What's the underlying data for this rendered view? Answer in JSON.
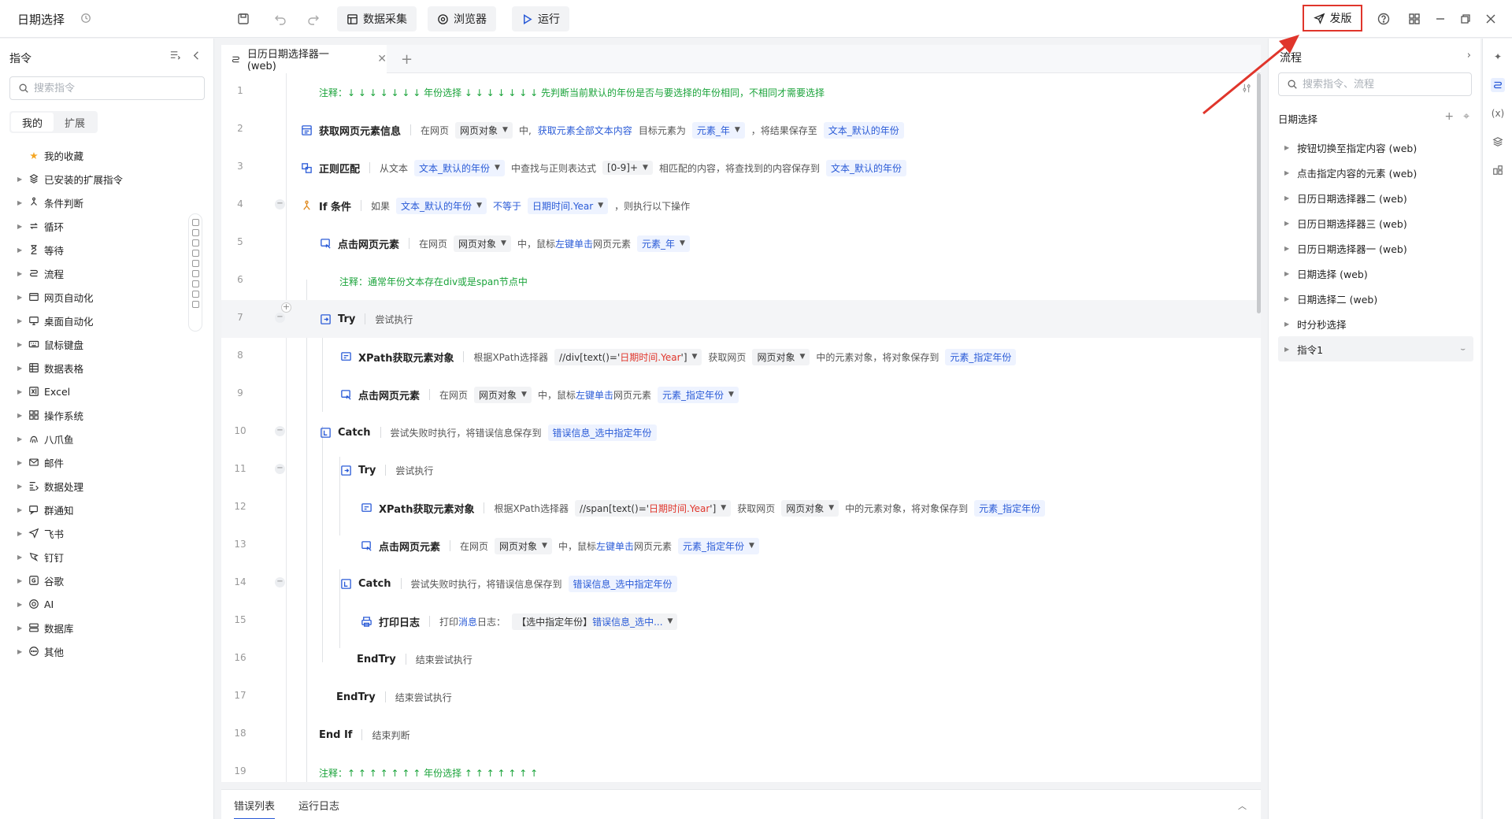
{
  "app": {
    "title": "日期选择",
    "toolbar": {
      "data_collect": "数据采集",
      "browser": "浏览器",
      "run": "运行",
      "publish": "发版"
    }
  },
  "left_panel": {
    "title": "指令",
    "search_placeholder": "搜索指令",
    "tabs": [
      "我的",
      "扩展"
    ],
    "categories": [
      {
        "label": "我的收藏",
        "icon": "star-icon",
        "caret": ""
      },
      {
        "label": "已安装的扩展指令",
        "icon": "extension-icon",
        "caret": "▶"
      },
      {
        "label": "条件判断",
        "icon": "branch-icon",
        "caret": "▶"
      },
      {
        "label": "循环",
        "icon": "loop-icon",
        "caret": "▶"
      },
      {
        "label": "等待",
        "icon": "hourglass-icon",
        "caret": "▶"
      },
      {
        "label": "流程",
        "icon": "flow-icon",
        "caret": "▶"
      },
      {
        "label": "网页自动化",
        "icon": "browser-window-icon",
        "caret": "▶"
      },
      {
        "label": "桌面自动化",
        "icon": "desktop-icon",
        "caret": "▶"
      },
      {
        "label": "鼠标键盘",
        "icon": "keyboard-icon",
        "caret": "▶"
      },
      {
        "label": "数据表格",
        "icon": "table-icon",
        "caret": "▶"
      },
      {
        "label": "Excel",
        "icon": "excel-icon",
        "caret": "▶"
      },
      {
        "label": "操作系统",
        "icon": "os-icon",
        "caret": "▶"
      },
      {
        "label": "八爪鱼",
        "icon": "octopus-icon",
        "caret": "▶"
      },
      {
        "label": "邮件",
        "icon": "mail-icon",
        "caret": "▶"
      },
      {
        "label": "数据处理",
        "icon": "data-process-icon",
        "caret": "▶"
      },
      {
        "label": "群通知",
        "icon": "group-notify-icon",
        "caret": "▶"
      },
      {
        "label": "飞书",
        "icon": "feishu-icon",
        "caret": "▶"
      },
      {
        "label": "钉钉",
        "icon": "dingtalk-icon",
        "caret": "▶"
      },
      {
        "label": "谷歌",
        "icon": "google-icon",
        "caret": "▶"
      },
      {
        "label": "AI",
        "icon": "ai-icon",
        "caret": "▶"
      },
      {
        "label": "数据库",
        "icon": "database-icon",
        "caret": "▶"
      },
      {
        "label": "其他",
        "icon": "more-icon",
        "caret": "▶"
      }
    ]
  },
  "editor": {
    "tab_label": "日历日期选择器一 (web)",
    "lines": [
      {
        "n": "1",
        "comment": "注释：↓ ↓ ↓ ↓ ↓ ↓ ↓  年份选择  ↓ ↓ ↓ ↓ ↓ ↓ ↓  先判断当前默认的年份是否与要选择的年份相同，不相同才需要选择"
      },
      {
        "n": "2",
        "name": "获取网页元素信息",
        "t1": "在网页",
        "c1": "网页对象",
        "t2": "中,",
        "b1": "获取元素全部文本内容",
        "t3": "目标元素为",
        "c2": "元素_年",
        "t4": "，将结果保存至",
        "c3": "文本_默认的年份"
      },
      {
        "n": "3",
        "name": "正则匹配",
        "t1": "从文本",
        "c1": "文本_默认的年份",
        "t2": "中查找与正则表达式",
        "c2": "[0-9]+",
        "t3": "相匹配的内容，将查找到的内容保存到",
        "c3": "文本_默认的年份"
      },
      {
        "n": "4",
        "name": "If 条件",
        "t1": "如果",
        "c1": "文本_默认的年份",
        "b1": "不等于",
        "c2": "日期时间.Year",
        "t2": "，则执行以下操作"
      },
      {
        "n": "5",
        "name": "点击网页元素",
        "t1": "在网页",
        "c1": "网页对象",
        "t2": "中，鼠标",
        "b1": "左键单击",
        "t3": "网页元素",
        "c2": "元素_年"
      },
      {
        "n": "6",
        "comment": "注释：通常年份文本存在div或是span节点中"
      },
      {
        "n": "7",
        "name": "Try",
        "t1": "尝试执行"
      },
      {
        "n": "8",
        "name": "XPath获取元素对象",
        "t1": "根据XPath选择器",
        "c1a": "//div[text()='",
        "c1b": "日期时间.Year",
        "c1c": "']",
        "t2": "获取网页",
        "c2": "网页对象",
        "t3": "中的元素对象，将对象保存到",
        "c3": "元素_指定年份"
      },
      {
        "n": "9",
        "name": "点击网页元素",
        "t1": "在网页",
        "c1": "网页对象",
        "t2": "中，鼠标",
        "b1": "左键单击",
        "t3": "网页元素",
        "c2": "元素_指定年份"
      },
      {
        "n": "10",
        "name": "Catch",
        "t1": "尝试失败时执行，将错误信息保存到",
        "c1": "错误信息_选中指定年份"
      },
      {
        "n": "11",
        "name": "Try",
        "t1": "尝试执行"
      },
      {
        "n": "12",
        "name": "XPath获取元素对象",
        "t1": "根据XPath选择器",
        "c1a": "//span[text()='",
        "c1b": "日期时间.Year",
        "c1c": "']",
        "t2": "获取网页",
        "c2": "网页对象",
        "t3": "中的元素对象，将对象保存到",
        "c3": "元素_指定年份"
      },
      {
        "n": "13",
        "name": "点击网页元素",
        "t1": "在网页",
        "c1": "网页对象",
        "t2": "中，鼠标",
        "b1": "左键单击",
        "t3": "网页元素",
        "c2": "元素_指定年份"
      },
      {
        "n": "14",
        "name": "Catch",
        "t1": "尝试失败时执行，将错误信息保存到",
        "c1": "错误信息_选中指定年份"
      },
      {
        "n": "15",
        "name": "打印日志",
        "t1": "打印",
        "b1": "消息",
        "t2": "日志：",
        "c1a": "【选中指定年份】",
        "c1b": "错误信息_选中..."
      },
      {
        "n": "16",
        "name": "EndTry",
        "t1": "结束尝试执行"
      },
      {
        "n": "17",
        "name": "EndTry",
        "t1": "结束尝试执行"
      },
      {
        "n": "18",
        "name": "End If",
        "t1": "结束判断"
      },
      {
        "n": "19",
        "comment": "注释：↑ ↑ ↑ ↑ ↑ ↑ ↑  年份选择  ↑ ↑ ↑ ↑ ↑ ↑ ↑"
      }
    ]
  },
  "bottom_panel": {
    "tabs": [
      "错误列表",
      "运行日志"
    ]
  },
  "right_panel": {
    "title": "流程",
    "search_placeholder": "搜索指令、流程",
    "group": "日期选择",
    "items": [
      "按钮切换至指定内容 (web)",
      "点击指定内容的元素 (web)",
      "日历日期选择器二 (web)",
      "日历日期选择器三 (web)",
      "日历日期选择器一 (web)",
      "日期选择 (web)",
      "日期选择二 (web)",
      "时分秒选择",
      "指令1"
    ]
  },
  "colors": {
    "accent": "#2a5bd7",
    "comment": "#1aa33a",
    "annotation": "#e0352b"
  }
}
